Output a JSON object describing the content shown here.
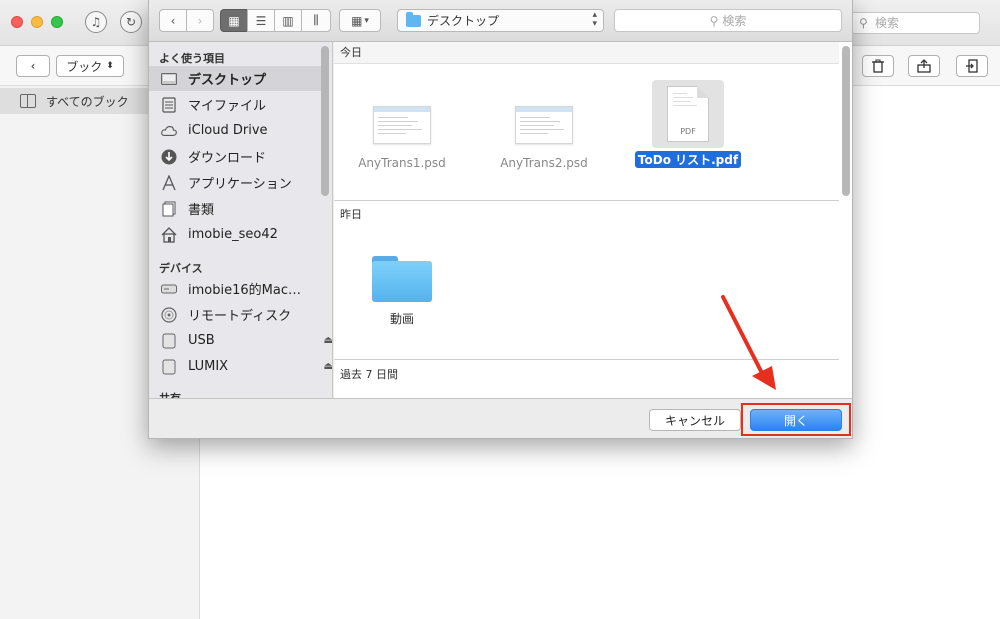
{
  "app": {
    "search_placeholder": "検索",
    "books_popup_label": "ブック",
    "sidebar_item_label": "すべてのブック"
  },
  "dialog": {
    "location_label": "デスクトップ",
    "search_placeholder": "検索",
    "sidebar": {
      "favorites_header": "よく使う項目",
      "favorites": [
        {
          "label": "デスクトップ",
          "icon": "desktop-icon"
        },
        {
          "label": "マイファイル",
          "icon": "all-files-icon"
        },
        {
          "label": "iCloud Drive",
          "icon": "cloud-icon"
        },
        {
          "label": "ダウンロード",
          "icon": "download-icon"
        },
        {
          "label": "アプリケーション",
          "icon": "applications-icon"
        },
        {
          "label": "書類",
          "icon": "documents-icon"
        },
        {
          "label": "imobie_seo42",
          "icon": "home-icon"
        }
      ],
      "devices_header": "デバイス",
      "devices": [
        {
          "label": "imobie16的Mac…",
          "icon": "computer-icon"
        },
        {
          "label": "リモートディスク",
          "icon": "disc-icon"
        },
        {
          "label": "USB",
          "icon": "drive-icon"
        },
        {
          "label": "LUMIX",
          "icon": "drive-icon"
        }
      ],
      "shared_header": "共有"
    },
    "groups": {
      "today": "今日",
      "yesterday": "昨日",
      "past7": "過去 7 日間"
    },
    "files": [
      {
        "name": "AnyTrans1.psd"
      },
      {
        "name": "AnyTrans2.psd"
      },
      {
        "name": "ToDo リスト.pdf",
        "type_tag": "PDF"
      },
      {
        "name": "動画"
      }
    ],
    "buttons": {
      "cancel": "キャンセル",
      "open": "開く"
    }
  },
  "colors": {
    "accent": "#2a84f0",
    "highlight": "#e62f1e",
    "selection": "#1e6fdc"
  }
}
